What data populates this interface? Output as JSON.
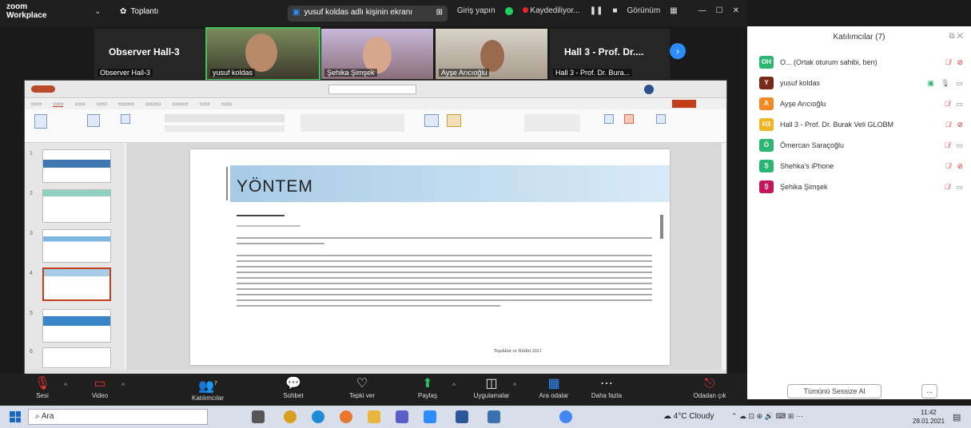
{
  "titlebar": {
    "app_line1": "zoom",
    "app_line2": "Workplace",
    "meeting": "Toplantı",
    "share_label": "yusuf koldas adlı kişinin ekranı",
    "tryout": "Giriş yapın",
    "recording": "Kaydediliyor...",
    "view": "Görünüm"
  },
  "strip": {
    "tiles": [
      {
        "label": "Observer Hall-3",
        "sub": "Observer Hall-3",
        "kind": "name"
      },
      {
        "label": "",
        "sub": "yusuf koldas",
        "kind": "video"
      },
      {
        "label": "",
        "sub": "Şehika Şimşek",
        "kind": "video"
      },
      {
        "label": "",
        "sub": "Ayşe Arıcıoğlu",
        "kind": "video"
      },
      {
        "label": "Hall 3 - Prof. Dr....",
        "sub": "Hall 3 - Prof. Dr. Bura...",
        "kind": "name"
      }
    ]
  },
  "slide": {
    "title": "YÖNTEM",
    "signature": "Teşekkür ve Bildiri 2021"
  },
  "panel": {
    "title": "Katılımcılar (7)",
    "participants": [
      {
        "initials": "OH",
        "name": "O... (Ortak oturum sahibi, ben)",
        "color": "#2bb673"
      },
      {
        "initials": "Y",
        "name": "yusuf koldas",
        "color": "#7a2a18"
      },
      {
        "initials": "A",
        "name": "Ayşe Arıcıoğlu",
        "color": "#f08a24"
      },
      {
        "initials": "H3",
        "name": "Hall 3 - Prof. Dr. Burak Veli GLOBM",
        "color": "#f0b429"
      },
      {
        "initials": "Ö",
        "name": "Ömercan Saraçoğlu",
        "color": "#2bb673"
      },
      {
        "initials": "Ş",
        "name": "Shehka's iPhone",
        "color": "#2bb673"
      },
      {
        "initials": "Ş",
        "name": "Şehika Şimşek",
        "color": "#c2185b"
      }
    ],
    "mute_all": "Tümünü Sessize Al",
    "more": "..."
  },
  "toolbar": {
    "mute": "Sesi",
    "video": "Video",
    "participants": "Katılımcılar",
    "participant_count": "7",
    "chat": "Sohbet",
    "react": "Tepki ver",
    "share": "Paylaş",
    "apps": "Uygulamalar",
    "whiteboard": "Ara odalar",
    "more": "Daha fazla",
    "leave": "Odadan çık"
  },
  "taskbar": {
    "search": "Ara",
    "weather": "4°C Cloudy",
    "time": "11:42",
    "date": "28.01.2021"
  },
  "colors": {
    "zoom_blue": "#2d8cff",
    "active_border": "#3ec65b",
    "muted_red": "#e02828"
  }
}
